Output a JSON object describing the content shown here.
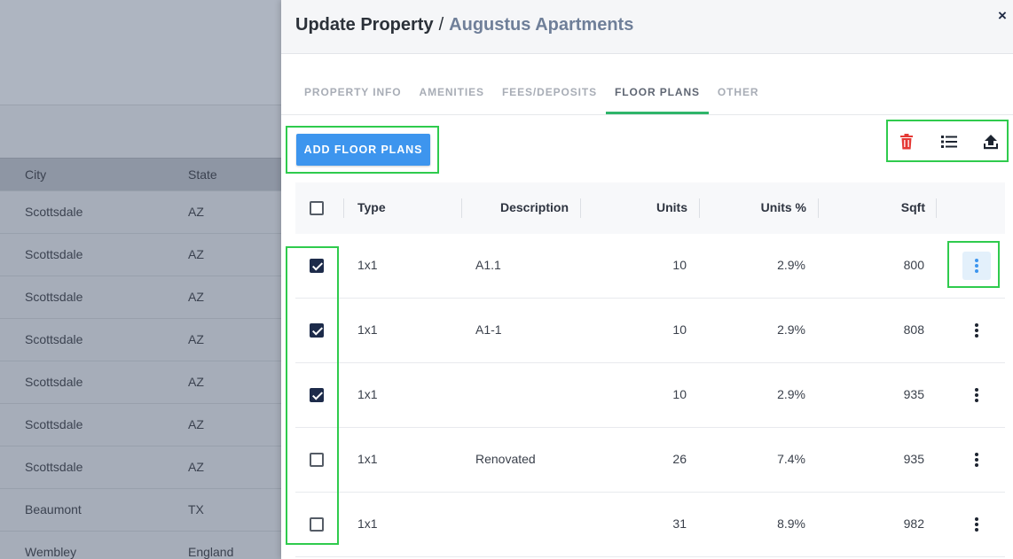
{
  "background": {
    "columns": [
      "City",
      "State"
    ],
    "rows": [
      {
        "city": "Scottsdale",
        "state": "AZ"
      },
      {
        "city": "Scottsdale",
        "state": "AZ"
      },
      {
        "city": "Scottsdale",
        "state": "AZ"
      },
      {
        "city": "Scottsdale",
        "state": "AZ"
      },
      {
        "city": "Scottsdale",
        "state": "AZ"
      },
      {
        "city": "Scottsdale",
        "state": "AZ"
      },
      {
        "city": "Scottsdale",
        "state": "AZ"
      },
      {
        "city": "Beaumont",
        "state": "TX"
      },
      {
        "city": "Wembley",
        "state": "England"
      }
    ]
  },
  "panel": {
    "title": "Update Property",
    "separator": "/",
    "subtitle": "Augustus Apartments",
    "close_label": "×"
  },
  "tabs": [
    {
      "label": "PROPERTY INFO",
      "active": false
    },
    {
      "label": "AMENITIES",
      "active": false
    },
    {
      "label": "FEES/DEPOSITS",
      "active": false
    },
    {
      "label": "FLOOR PLANS",
      "active": true
    },
    {
      "label": "OTHER",
      "active": false
    }
  ],
  "toolbar": {
    "add_label": "ADD FLOOR PLANS",
    "icons": [
      "trash-icon",
      "list-icon",
      "upload-icon"
    ],
    "delete_color": "#e53935"
  },
  "table": {
    "columns": {
      "type": "Type",
      "description": "Description",
      "units": "Units",
      "units_pct": "Units %",
      "sqft": "Sqft"
    },
    "rows": [
      {
        "checked": true,
        "type": "1x1",
        "description": "A1.1",
        "units": "10",
        "units_pct": "2.9%",
        "sqft": "800",
        "menu_focused": true
      },
      {
        "checked": true,
        "type": "1x1",
        "description": "A1-1",
        "units": "10",
        "units_pct": "2.9%",
        "sqft": "808",
        "menu_focused": false
      },
      {
        "checked": true,
        "type": "1x1",
        "description": "",
        "units": "10",
        "units_pct": "2.9%",
        "sqft": "935",
        "menu_focused": false
      },
      {
        "checked": false,
        "type": "1x1",
        "description": "Renovated",
        "units": "26",
        "units_pct": "7.4%",
        "sqft": "935",
        "menu_focused": false
      },
      {
        "checked": false,
        "type": "1x1",
        "description": "",
        "units": "31",
        "units_pct": "8.9%",
        "sqft": "982",
        "menu_focused": false
      }
    ]
  },
  "colors": {
    "accent": "#3d95ee",
    "tab_indicator": "#2fb56a",
    "highlight_box": "#2fcb4d",
    "checkbox_checked": "#1d2b4a"
  }
}
